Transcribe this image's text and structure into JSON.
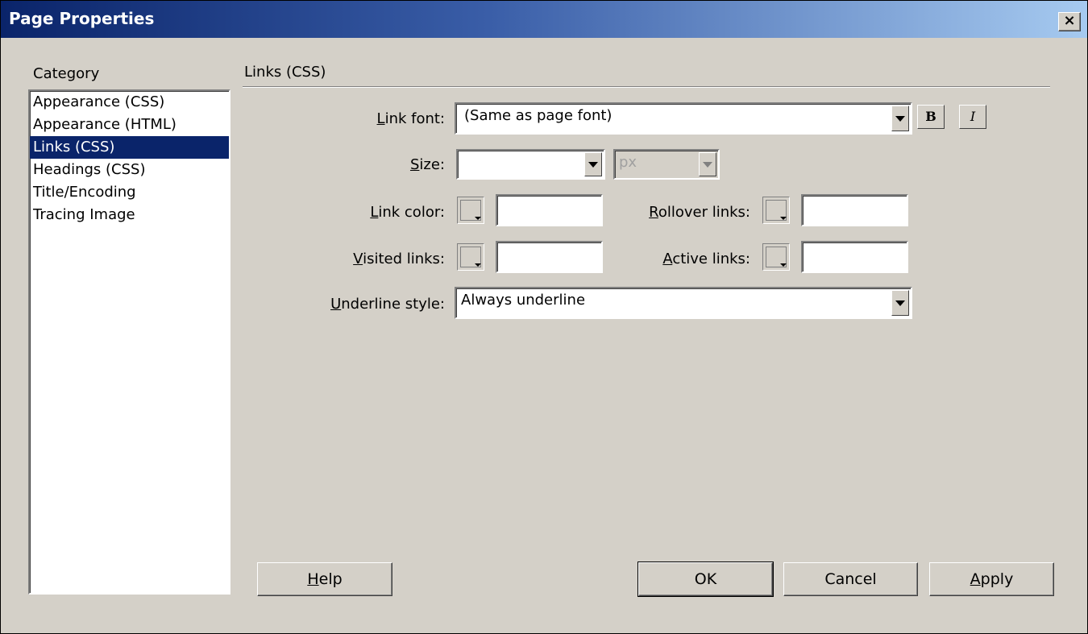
{
  "window": {
    "title": "Page Properties",
    "close_label": "×"
  },
  "category": {
    "label": "Category",
    "items": [
      {
        "label": "Appearance (CSS)",
        "selected": false
      },
      {
        "label": "Appearance (HTML)",
        "selected": false
      },
      {
        "label": "Links (CSS)",
        "selected": true
      },
      {
        "label": "Headings (CSS)",
        "selected": false
      },
      {
        "label": "Title/Encoding",
        "selected": false
      },
      {
        "label": "Tracing Image",
        "selected": false
      }
    ]
  },
  "panel": {
    "title": "Links (CSS)",
    "link_font": {
      "label_mn": "L",
      "label_rest": "ink font:",
      "value": "(Same as page font)"
    },
    "bold_label": "B",
    "italic_label": "I",
    "size": {
      "label_mn": "S",
      "label_rest": "ize:",
      "value": "",
      "unit": "px"
    },
    "link_color": {
      "label_mn": "L",
      "label_rest": "ink color:",
      "value": ""
    },
    "rollover_links": {
      "label_mn": "R",
      "label_rest": "ollover links:",
      "value": ""
    },
    "visited_links": {
      "label_mn": "V",
      "label_rest": "isited links:",
      "value": ""
    },
    "active_links": {
      "label_mn": "A",
      "label_rest": "ctive links:",
      "value": ""
    },
    "underline_style": {
      "label_mn": "U",
      "label_rest": "nderline style:",
      "value": "Always underline"
    }
  },
  "buttons": {
    "help": {
      "mn": "H",
      "rest": "elp"
    },
    "ok": "OK",
    "cancel": "Cancel",
    "apply": {
      "mn": "A",
      "rest": "pply"
    }
  }
}
